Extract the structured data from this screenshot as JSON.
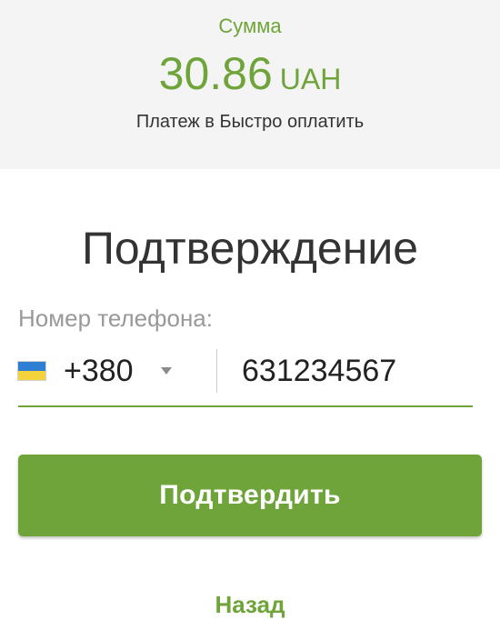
{
  "summary": {
    "sum_label": "Сумма",
    "amount": "30.86",
    "currency": "UAH",
    "payment_description": "Платеж в Быстро оплатить"
  },
  "confirmation": {
    "title": "Подтверждение",
    "phone_label": "Номер телефона:",
    "country_code": "+380",
    "country_flag": "ukraine-flag",
    "phone_value": "631234567"
  },
  "actions": {
    "confirm_label": "Подтвердить",
    "back_label": "Назад"
  },
  "colors": {
    "accent": "#6fa43a",
    "summary_background": "#f4f4f4",
    "text": "#333333",
    "muted": "#999999"
  }
}
